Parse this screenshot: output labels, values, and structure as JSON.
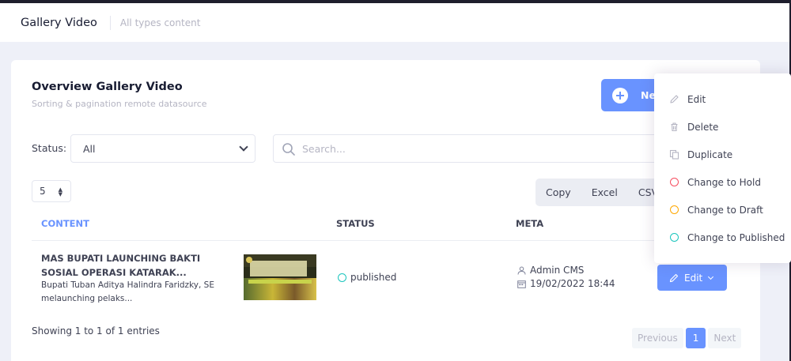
{
  "subheader": {
    "title": "Gallery Video",
    "description": "All types content"
  },
  "card": {
    "title": "Overview Gallery Video",
    "subtitle": "Sorting & pagination remote datasource"
  },
  "new_button": {
    "label": "Ne",
    "icon": "plus-circle-icon"
  },
  "filters": {
    "status_label": "Status:",
    "status_selected": "All",
    "search_placeholder": "Search...",
    "page_length": "5"
  },
  "export_buttons": [
    "Copy",
    "Excel",
    "CSV"
  ],
  "table": {
    "columns": [
      "CONTENT",
      "STATUS",
      "META"
    ],
    "rows": [
      {
        "title": "MAS BUPATI LAUNCHING BAKTI SOSIAL OPERASI KATARAK...",
        "description": "Bupati Tuban Aditya Halindra Faridzky, SE melaunching pelaks...",
        "status": "published",
        "author": "Admin CMS",
        "date": "19/02/2022 18:44",
        "action_label": "Edit"
      }
    ]
  },
  "footer": {
    "info": "Showing 1 to 1 of 1 entries",
    "pagination": {
      "previous": "Previous",
      "current": "1",
      "next": "Next"
    }
  },
  "action_menu": {
    "items": [
      {
        "label": "Edit",
        "icon": "pencil-icon"
      },
      {
        "label": "Delete",
        "icon": "trash-icon"
      },
      {
        "label": "Duplicate",
        "icon": "copy-icon"
      },
      {
        "label": "Change to Hold",
        "icon": "circle-icon",
        "color": "#f64e60"
      },
      {
        "label": "Change to Draft",
        "icon": "circle-icon",
        "color": "#ffa800"
      },
      {
        "label": "Change to Published",
        "icon": "circle-icon",
        "color": "#1bc5bd"
      }
    ]
  },
  "colors": {
    "primary": "#6993ff",
    "success": "#1bc5bd",
    "danger": "#f64e60",
    "warning": "#ffa800"
  }
}
